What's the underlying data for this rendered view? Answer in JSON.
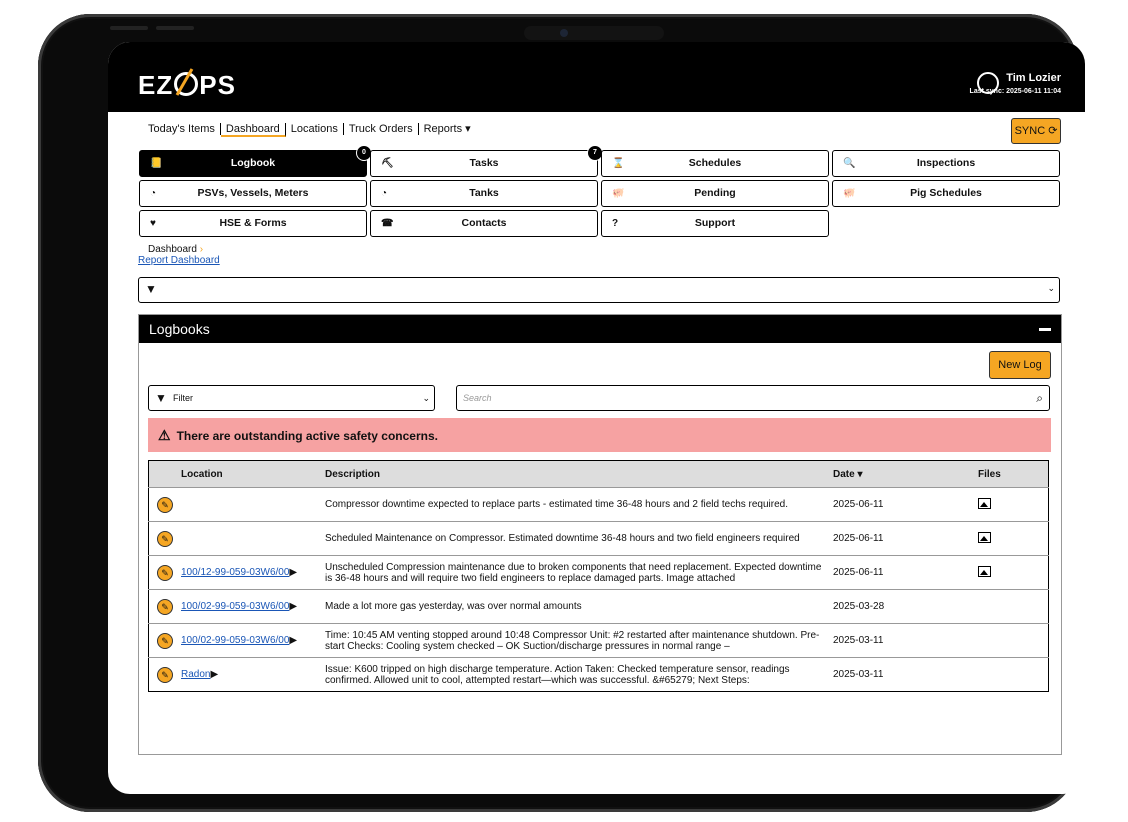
{
  "app": {
    "logo": "EZOPS"
  },
  "user": {
    "name": "Tim Lozier",
    "last_sync": "Last sync: 2025-06-11 11:04"
  },
  "nav": {
    "items": [
      "Today's Items",
      "Dashboard",
      "Locations",
      "Truck Orders",
      "Reports ▾"
    ],
    "active": "Dashboard"
  },
  "sync_button": "SYNC ⟳",
  "tiles": [
    {
      "label": "Logbook",
      "icon": "📒",
      "badge": "0"
    },
    {
      "label": "Tasks",
      "icon": "⛏",
      "badge": "7"
    },
    {
      "label": "Schedules",
      "icon": "⌛",
      "badge": ""
    },
    {
      "label": "Inspections",
      "icon": "🔍",
      "badge": ""
    },
    {
      "label": "PSVs, Vessels, Meters",
      "icon": "◔",
      "badge": ""
    },
    {
      "label": "Tanks",
      "icon": "◔",
      "badge": ""
    },
    {
      "label": "Pending",
      "icon": "🐖",
      "badge": ""
    },
    {
      "label": "Pig Schedules",
      "icon": "🐖",
      "badge": ""
    },
    {
      "label": "HSE & Forms",
      "icon": "♥",
      "badge": ""
    },
    {
      "label": "Contacts",
      "icon": "☎",
      "badge": ""
    },
    {
      "label": "Support",
      "icon": "?",
      "badge": ""
    }
  ],
  "breadcrumb": {
    "current": "Dashboard",
    "link": "Report Dashboard"
  },
  "panel": {
    "title": "Logbooks",
    "new_log": "New Log",
    "filter_placeholder": "Filter",
    "search_placeholder": "Search",
    "alert": "There are outstanding active safety concerns.",
    "columns": [
      "Location",
      "Description",
      "Date",
      "Files"
    ],
    "rows": [
      {
        "location": "",
        "description": "Compressor downtime expected to replace parts - estimated time 36-48 hours and 2 field techs required.",
        "date": "2025-06-11",
        "file": true
      },
      {
        "location": "",
        "description": "Scheduled Maintenance on Compressor.  Estimated downtime 36-48 hours and two field engineers required",
        "date": "2025-06-11",
        "file": true
      },
      {
        "location": "100/12-99-059-03W6/00",
        "description": "Unscheduled Compression maintenance due to broken components that need replacement.  Expected downtime is 36-48 hours and will require two field engineers to replace damaged parts.  Image attached",
        "date": "2025-06-11",
        "file": true
      },
      {
        "location": "100/02-99-059-03W6/00",
        "description": "Made a lot more gas yesterday, was over normal amounts",
        "date": "2025-03-28",
        "file": false
      },
      {
        "location": "100/02-99-059-03W6/00",
        "description": "Time: 10:45 AM venting stopped around 10:48 Compressor Unit: #2 restarted after maintenance shutdown. Pre-start Checks: Cooling system checked – OK Suction/discharge pressures in normal range –",
        "date": "2025-03-11",
        "file": false
      },
      {
        "location": "Radon",
        "description": "Issue: K600  tripped on high discharge temperature. Action Taken: Checked temperature sensor, readings confirmed. Allowed unit to cool, attempted restart—which was successful. &#65279; Next Steps:",
        "date": "2025-03-11",
        "file": false
      }
    ]
  }
}
